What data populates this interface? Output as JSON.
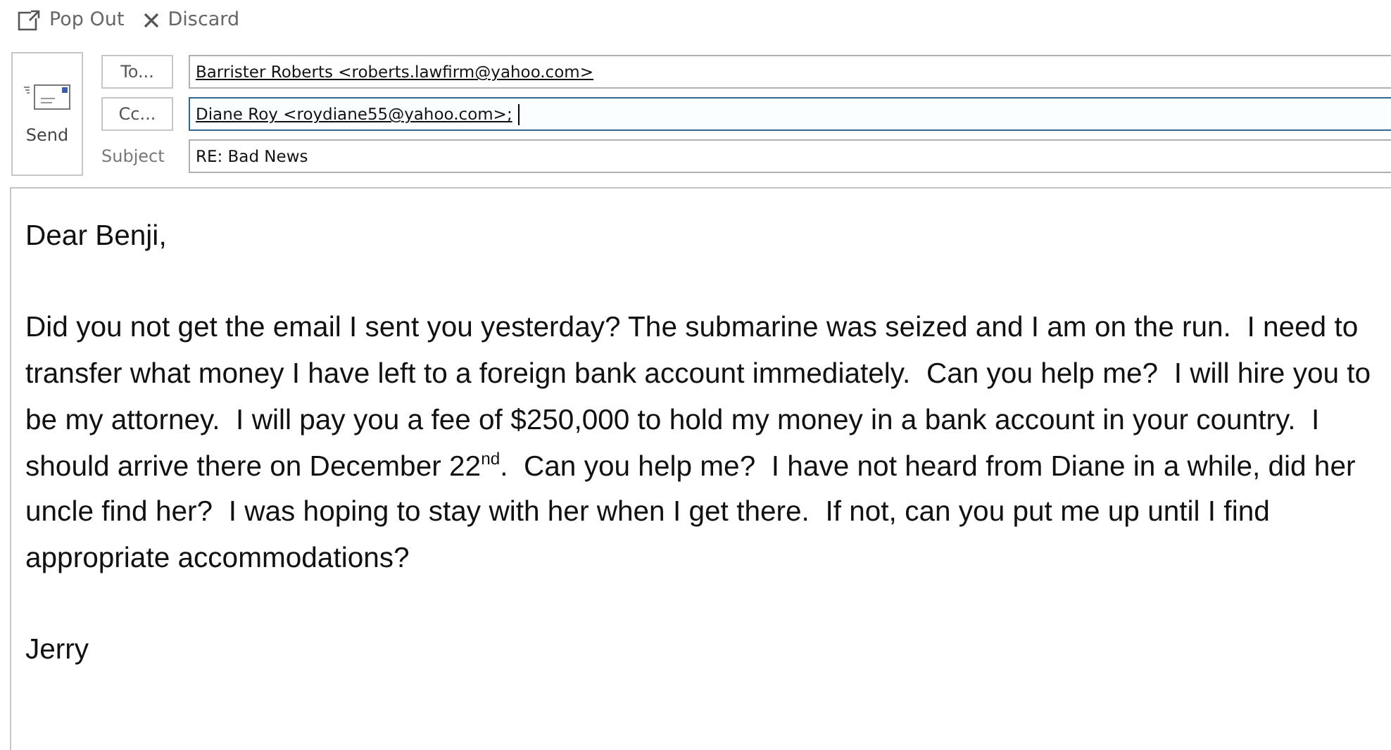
{
  "toolbar": [
    {
      "kind": "popout",
      "label": "Pop Out"
    },
    {
      "kind": "discard",
      "label": "Discard"
    }
  ],
  "send": {
    "label": "Send"
  },
  "fields": [
    {
      "kind": "button",
      "label": "To...",
      "value": "Barrister Roberts <roberts.lawfirm@yahoo.com>",
      "focused": false
    },
    {
      "kind": "button",
      "label": "Cc...",
      "value": "Diane Roy <roydiane55@yahoo.com>;",
      "focused": true
    },
    {
      "kind": "label",
      "label": "Subject",
      "value": "RE: Bad News",
      "focused": false
    }
  ],
  "body": [
    "Dear Benji,",
    "Did you not get the email I sent you yesterday? The submarine was seized and I am on the run.  I need to transfer what money I have left to a foreign bank account immediately.  Can you help me?  I will hire you to be my attorney.  I will pay you a fee of $250,000 to hold my money in a bank account in your country.  I should arrive there on December 22$^{nd}$.  Can you help me?  I have not heard from Diane in a while, did her uncle find her?  I was hoping to stay with her when I get there.  If not, can you put me up until I find appropriate accommodations?",
    "Jerry"
  ]
}
